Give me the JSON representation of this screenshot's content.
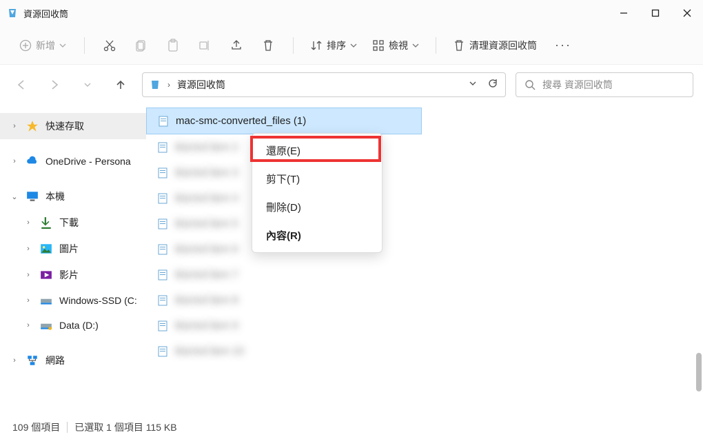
{
  "window": {
    "title": "資源回收筒"
  },
  "toolbar": {
    "new": "新增",
    "sort": "排序",
    "view": "檢視",
    "empty": "清理資源回收筒"
  },
  "path": {
    "location": "資源回收筒"
  },
  "search": {
    "placeholder": "搜尋 資源回收筒"
  },
  "sidebar": {
    "quick": "快速存取",
    "onedrive": "OneDrive - Persona",
    "thispc": "本機",
    "downloads": "下載",
    "pictures": "圖片",
    "videos": "影片",
    "cdrive": "Windows-SSD (C:",
    "ddrive": "Data (D:)",
    "network": "網路"
  },
  "files": [
    {
      "name": "mac-smc-converted_files (1)",
      "selected": true
    },
    {
      "name": "blurred item 2",
      "selected": false
    },
    {
      "name": "blurred item 3",
      "selected": false
    },
    {
      "name": "blurred item 4",
      "selected": false
    },
    {
      "name": "blurred item 5",
      "selected": false
    },
    {
      "name": "blurred item 6",
      "selected": false
    },
    {
      "name": "blurred item 7",
      "selected": false
    },
    {
      "name": "blurred item 8",
      "selected": false
    },
    {
      "name": "blurred item 9",
      "selected": false
    },
    {
      "name": "blurred item 10",
      "selected": false
    }
  ],
  "context_menu": {
    "restore": "還原(E)",
    "cut": "剪下(T)",
    "delete": "刪除(D)",
    "properties": "內容(R)"
  },
  "status": {
    "count": "109 個項目",
    "selection": "已選取 1 個項目  115 KB"
  }
}
